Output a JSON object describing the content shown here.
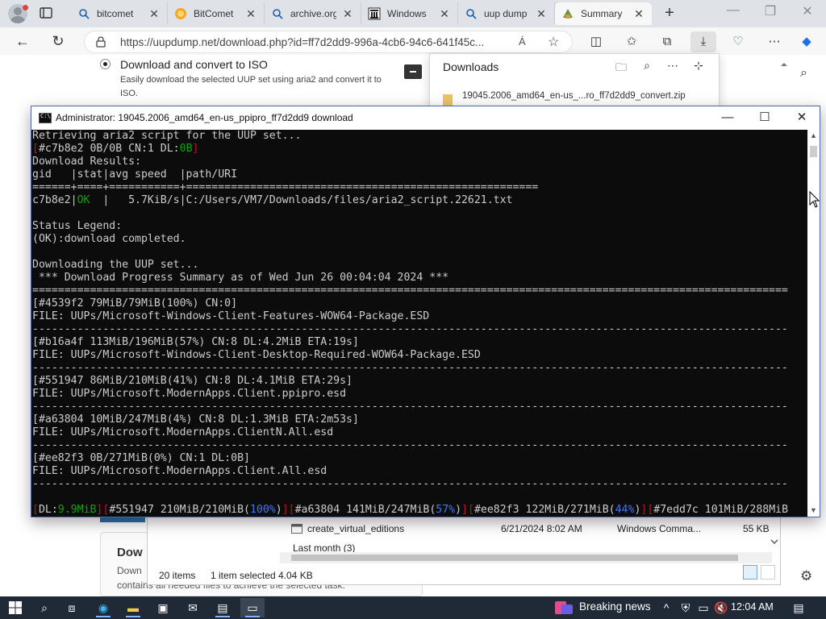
{
  "browser": {
    "tabs": [
      {
        "label": "bitcomet",
        "icon": "search-icon",
        "active": false
      },
      {
        "label": "BitComet",
        "icon": "bitcomet-icon",
        "active": false
      },
      {
        "label": "archive.org",
        "icon": "search-icon",
        "active": false
      },
      {
        "label": "Windows",
        "icon": "archive-org-icon",
        "active": false
      },
      {
        "label": "uup dump",
        "icon": "search-icon",
        "active": false
      },
      {
        "label": "Summary",
        "icon": "uupdump-icon",
        "active": true
      }
    ],
    "new_tab_label": "+",
    "url": "https://uupdump.net/download.php?id=ff7d2dd9-996a-4cb6-94c6-641f45c...",
    "read_aloud_label": "Á"
  },
  "page": {
    "option_title": "Download and convert to ISO",
    "option_desc": "Easily download the selected UUP set using aria2 and convert it to ISO.",
    "card_title": "Dow",
    "card_line1": "Down",
    "card_line2": "contains all needed files to achieve the selected task."
  },
  "downloads": {
    "title": "Downloads",
    "file": "19045.2006_amd64_en-us_...ro_ff7d2dd9_convert.zip"
  },
  "explorer": {
    "file_name": "create_virtual_editions",
    "file_date": "6/21/2024 8:02 AM",
    "file_type": "Windows Comma...",
    "file_size": "55 KB",
    "group": "Last month (3)",
    "items": "20 items",
    "selected": "1 item selected",
    "selected_size": "4.04 KB"
  },
  "console": {
    "title": "Administrator:  19045.2006_amd64_en-us_ppipro_ff7d2dd9 download",
    "lines": [
      [
        {
          "t": "Retrieving aria2 script for the UUP set..."
        }
      ],
      [
        {
          "t": "[",
          "c": "r"
        },
        {
          "t": "#c7b8e2 0B/0B CN:1 DL:"
        },
        {
          "t": "0B",
          "c": "g"
        },
        {
          "t": "]",
          "c": "r"
        }
      ],
      [
        {
          "t": "Download Results:"
        }
      ],
      [
        {
          "t": "gid   |stat|avg speed  |path/URI"
        }
      ],
      [
        {
          "t": "======+====+===========+======================================================="
        }
      ],
      [
        {
          "t": "c7b8e2|"
        },
        {
          "t": "OK",
          "c": "g"
        },
        {
          "t": "  |   5.7KiB/s|C:/Users/VM7/Downloads/files/aria2_script.22621.txt"
        }
      ],
      [
        {
          "t": ""
        }
      ],
      [
        {
          "t": "Status Legend:"
        }
      ],
      [
        {
          "t": "(OK):download completed."
        }
      ],
      [
        {
          "t": ""
        }
      ],
      [
        {
          "t": "Downloading the UUP set..."
        }
      ],
      [
        {
          "t": " *** Download Progress Summary as of Wed Jun 26 00:04:04 2024 ***"
        }
      ],
      [
        {
          "t": "======================================================================================================================"
        }
      ],
      [
        {
          "t": "[#4539f2 79MiB/79MiB(100%) CN:0]"
        }
      ],
      [
        {
          "t": "FILE: UUPs/Microsoft-Windows-Client-Features-WOW64-Package.ESD"
        }
      ],
      [
        {
          "t": "----------------------------------------------------------------------------------------------------------------------"
        }
      ],
      [
        {
          "t": "[#b16a4f 113MiB/196MiB(57%) CN:8 DL:4.2MiB ETA:19s]"
        }
      ],
      [
        {
          "t": "FILE: UUPs/Microsoft-Windows-Client-Desktop-Required-WOW64-Package.ESD"
        }
      ],
      [
        {
          "t": "----------------------------------------------------------------------------------------------------------------------"
        }
      ],
      [
        {
          "t": "[#551947 86MiB/210MiB(41%) CN:8 DL:4.1MiB ETA:29s]"
        }
      ],
      [
        {
          "t": "FILE: UUPs/Microsoft.ModernApps.Client.ppipro.esd"
        }
      ],
      [
        {
          "t": "----------------------------------------------------------------------------------------------------------------------"
        }
      ],
      [
        {
          "t": "[#a63804 10MiB/247MiB(4%) CN:8 DL:1.3MiB ETA:2m53s]"
        }
      ],
      [
        {
          "t": "FILE: UUPs/Microsoft.ModernApps.ClientN.All.esd"
        }
      ],
      [
        {
          "t": "----------------------------------------------------------------------------------------------------------------------"
        }
      ],
      [
        {
          "t": "[#ee82f3 0B/271MiB(0%) CN:1 DL:0B]"
        }
      ],
      [
        {
          "t": "FILE: UUPs/Microsoft.ModernApps.Client.All.esd"
        }
      ],
      [
        {
          "t": "----------------------------------------------------------------------------------------------------------------------"
        }
      ],
      [
        {
          "t": ""
        }
      ],
      [
        {
          "t": "[",
          "c": "r"
        },
        {
          "t": "DL:"
        },
        {
          "t": "9.9MiB",
          "c": "g"
        },
        {
          "t": "][",
          "c": "r"
        },
        {
          "t": "#551947 210MiB/210MiB("
        },
        {
          "t": "100%",
          "c": "b"
        },
        {
          "t": ")"
        },
        {
          "t": "][",
          "c": "r"
        },
        {
          "t": "#a63804 141MiB/247MiB("
        },
        {
          "t": "57%",
          "c": "b"
        },
        {
          "t": ")"
        },
        {
          "t": "][",
          "c": "r"
        },
        {
          "t": "#ee82f3 122MiB/271MiB("
        },
        {
          "t": "44%",
          "c": "b"
        },
        {
          "t": ")"
        },
        {
          "t": "][",
          "c": "r"
        },
        {
          "t": "#7edd7c 101MiB/288MiB"
        }
      ]
    ]
  },
  "taskbar": {
    "news": "Breaking news",
    "time": "12:04 AM"
  },
  "colors": {
    "console_bg": "#0c0c0c",
    "console_text": "#cccccc",
    "ok_green": "#13a10e",
    "bracket_red": "#c50f1f",
    "percent_blue": "#3b78ff",
    "taskbar_bg": "#1f2a36"
  }
}
